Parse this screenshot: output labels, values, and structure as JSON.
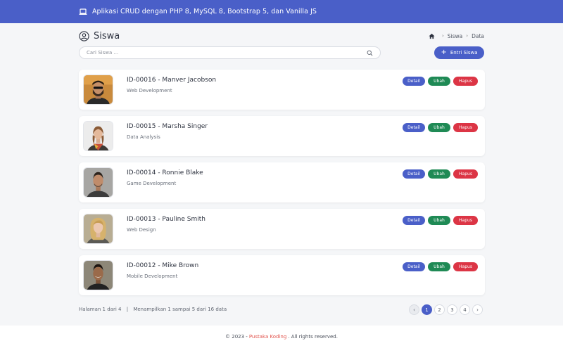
{
  "app": {
    "title": "Aplikasi CRUD dengan PHP 8, MySQL 8, Bootstrap 5, dan Vanilla JS",
    "icon": "laptop-icon"
  },
  "header": {
    "title": "Siswa",
    "icon": "user-circle-icon"
  },
  "breadcrumb": {
    "items": [
      "Siswa",
      "Data"
    ],
    "home_icon": "home-icon"
  },
  "search": {
    "placeholder": "Cari Siswa ...",
    "value": ""
  },
  "add_button": {
    "label": "Entri Siswa",
    "icon": "plus-icon"
  },
  "students": [
    {
      "name": "ID-00016 - Manver Jacobson",
      "class": "Web Development"
    },
    {
      "name": "ID-00015 - Marsha Singer",
      "class": "Data Analysis"
    },
    {
      "name": "ID-00014 - Ronnie Blake",
      "class": "Game Development"
    },
    {
      "name": "ID-00013 - Pauline Smith",
      "class": "Web Design"
    },
    {
      "name": "ID-00012 - Mike Brown",
      "class": "Mobile Development"
    }
  ],
  "actions": {
    "detail": "Detail",
    "edit": "Ubah",
    "delete": "Hapus"
  },
  "pagination": {
    "page_text": "Halaman 1 dari 4",
    "divider": "|",
    "showing_text": "Menampilkan 1 sampai 5 dari 16 data",
    "prev": "‹",
    "pages": [
      "1",
      "2",
      "3",
      "4"
    ],
    "next": "›",
    "current": "1"
  },
  "footer": {
    "prefix": "© 2023 -",
    "brand": "Pustaka Koding",
    "suffix": ". All rights reserved."
  },
  "colors": {
    "primary": "#4a5fc8",
    "success": "#1f8a55",
    "danger": "#dc3545",
    "brand_link": "#e2564f"
  }
}
